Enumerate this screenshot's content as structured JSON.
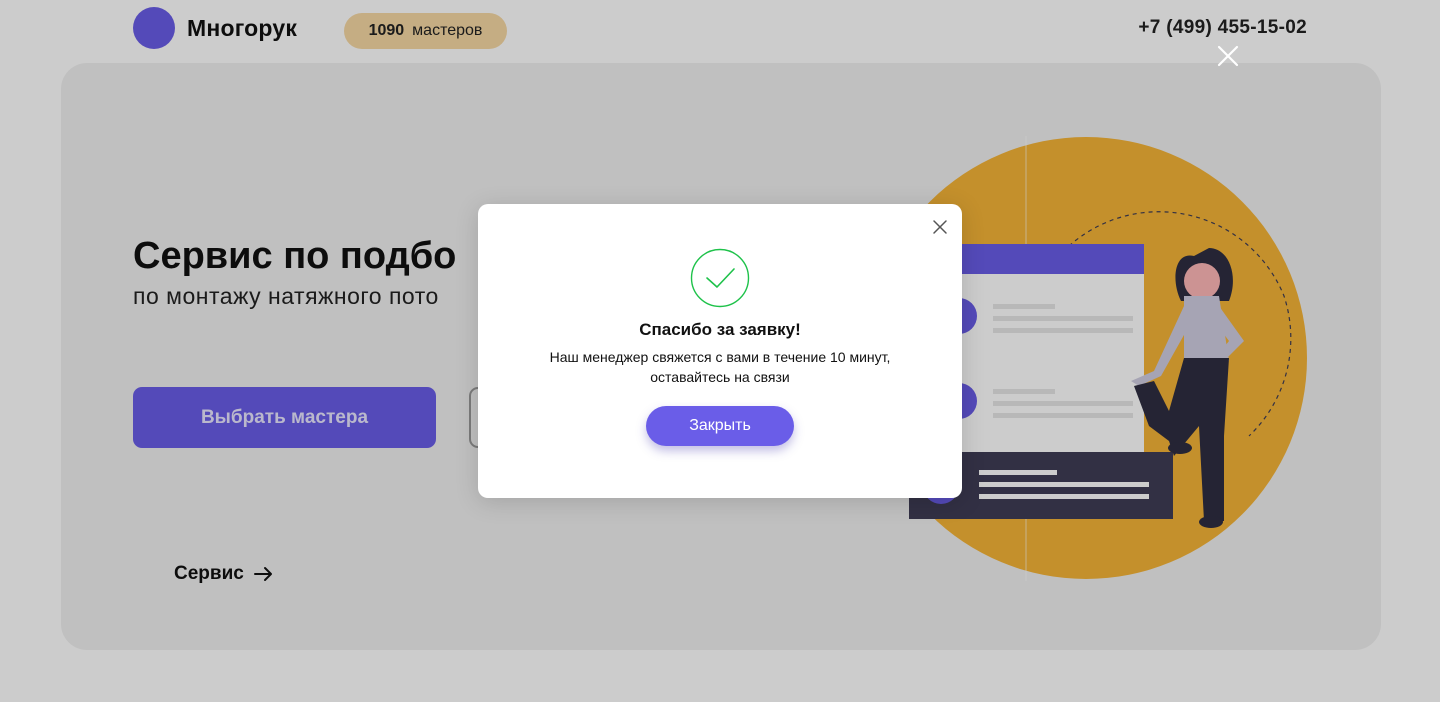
{
  "header": {
    "logo_text": "Многорук",
    "masters_count": "1090",
    "masters_label": "мастеров",
    "phone": "+7 (499) 455-15-02"
  },
  "hero": {
    "title": "Сервис по подбо",
    "subtitle": "по монтажу натяжного пото",
    "choose_button": "Выбрать мастера",
    "service_link": "Сервис"
  },
  "modal": {
    "title": "Спасибо за заявку!",
    "text_line1": "Наш менеджер свяжется с вами в течение 10 минут,",
    "text_line2": "оставайтесь на связи",
    "close_button": "Закрыть"
  },
  "icons": {
    "logo": "logo-circle-icon",
    "service_arrow": "arrow-right-icon",
    "success": "checkmark-circle-icon",
    "modal_close": "close-icon",
    "overlay_close": "close-icon"
  },
  "colors": {
    "accent": "#6a5de8",
    "badge": "#f7d9a4",
    "success": "#1ec24a",
    "illustration_circle": "#f5b437",
    "illustration_dark": "#3f3d56"
  }
}
